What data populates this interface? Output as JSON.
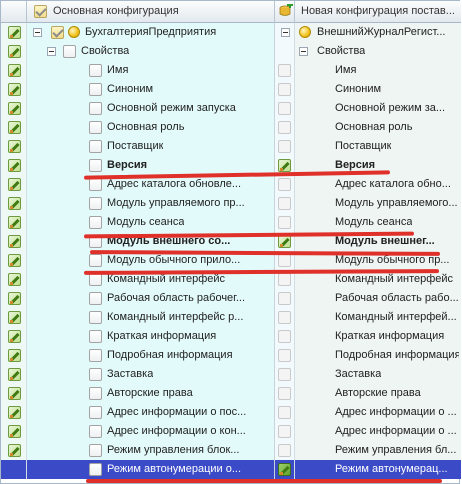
{
  "header": {
    "left_title": "Основная конфигурация",
    "right_title": "Новая конфигурация постав..."
  },
  "colors": {
    "selection": "#3b4bc8",
    "annotation": "#e0302a",
    "cell_bg": "#e3fafa"
  },
  "icons": {
    "edit": "pencil-icon",
    "config": "config-object-icon",
    "database": "database-plus-icon"
  },
  "rows": [
    {
      "left": "БухгалтерияПредприятия",
      "right": "ВнешнийЖурналРегист...",
      "type": "root",
      "right_pencil": false
    },
    {
      "left": "Свойства",
      "right": "Свойства",
      "type": "group",
      "right_pencil": false
    },
    {
      "left": "Имя",
      "right": "Имя",
      "type": "prop",
      "right_pencil": false
    },
    {
      "left": "Синоним",
      "right": "Синоним",
      "type": "prop",
      "right_pencil": false
    },
    {
      "left": "Основной режим запуска",
      "right": "Основной режим за...",
      "type": "prop",
      "right_pencil": false
    },
    {
      "left": "Основная роль",
      "right": "Основная роль",
      "type": "prop",
      "right_pencil": false
    },
    {
      "left": "Поставщик",
      "right": "Поставщик",
      "type": "prop",
      "right_pencil": false
    },
    {
      "left": "Версия",
      "right": "Версия",
      "type": "prop",
      "bold": true,
      "right_pencil": true
    },
    {
      "left": "Адрес каталога обновле...",
      "right": "Адрес каталога обно...",
      "type": "prop",
      "right_pencil": false
    },
    {
      "left": "Модуль управляемого пр...",
      "right": "Модуль управляемого...",
      "type": "prop",
      "right_pencil": false
    },
    {
      "left": "Модуль сеанса",
      "right": "Модуль сеанса",
      "type": "prop",
      "right_pencil": false
    },
    {
      "left": "Модуль внешнего со...",
      "right": "Модуль внешнег...",
      "type": "prop",
      "bold": true,
      "right_pencil": true
    },
    {
      "left": "Модуль обычного прило...",
      "right": "Модуль обычного пр...",
      "type": "prop",
      "right_pencil": false
    },
    {
      "left": "Командный интерфейс",
      "right": "Командный интерфейс",
      "type": "prop",
      "right_pencil": false
    },
    {
      "left": "Рабочая область рабочег...",
      "right": "Рабочая область рабо...",
      "type": "prop",
      "right_pencil": false
    },
    {
      "left": "Командный интерфейс р...",
      "right": "Командный интерфей...",
      "type": "prop",
      "right_pencil": false
    },
    {
      "left": "Краткая информация",
      "right": "Краткая информация",
      "type": "prop",
      "right_pencil": false
    },
    {
      "left": "Подробная информация",
      "right": "Подробная информация",
      "type": "prop",
      "right_pencil": false
    },
    {
      "left": "Заставка",
      "right": "Заставка",
      "type": "prop",
      "right_pencil": false
    },
    {
      "left": "Авторские права",
      "right": "Авторские права",
      "type": "prop",
      "right_pencil": false
    },
    {
      "left": "Адрес информации о пос...",
      "right": "Адрес информации о ...",
      "type": "prop",
      "right_pencil": false
    },
    {
      "left": "Адрес информации о кон...",
      "right": "Адрес информации о ...",
      "type": "prop",
      "right_pencil": false
    },
    {
      "left": "Режим управления блок...",
      "right": "Режим управления бл...",
      "type": "prop",
      "right_pencil": false
    },
    {
      "left": "Режим автонумерации о...",
      "right": "Режим автонумерац...",
      "type": "prop",
      "selected": true,
      "right_pencil": true
    }
  ]
}
